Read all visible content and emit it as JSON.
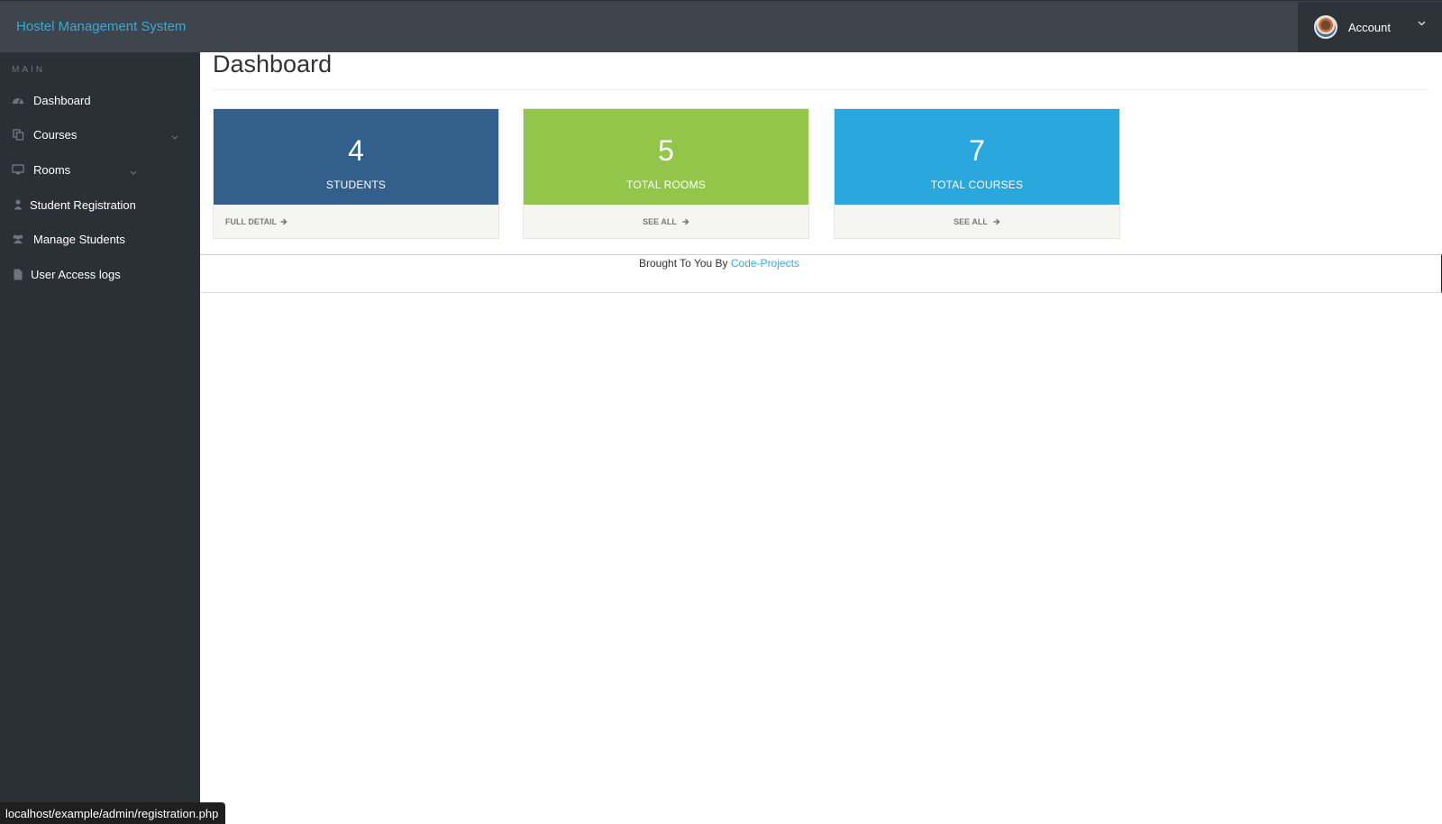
{
  "header": {
    "brand": "Hostel Management System",
    "account_label": "Account"
  },
  "sidebar": {
    "heading": "MAIN",
    "items": [
      {
        "label": "Dashboard",
        "icon": "dashboard-icon"
      },
      {
        "label": "Courses",
        "icon": "copy-icon",
        "expandable": true
      },
      {
        "label": "Rooms",
        "icon": "desktop-icon",
        "expandable": true
      },
      {
        "label": "Student Registration",
        "icon": "user-icon"
      },
      {
        "label": "Manage Students",
        "icon": "users-icon"
      },
      {
        "label": "User Access logs",
        "icon": "file-icon"
      }
    ]
  },
  "main": {
    "title": "Dashboard",
    "cards": [
      {
        "value": "4",
        "label": "STUDENTS",
        "link": "FULL DETAIL",
        "color": "#335f8c"
      },
      {
        "value": "5",
        "label": "TOTAL ROOMS",
        "link": "SEE ALL",
        "color": "#93c54b"
      },
      {
        "value": "7",
        "label": "TOTAL COURSES",
        "link": "SEE ALL",
        "color": "#2aa8de"
      }
    ]
  },
  "footer": {
    "text": "Brought To You By",
    "link": "Code-Projects"
  },
  "status_bar": {
    "url": "localhost/example/admin/registration.php"
  },
  "colors": {
    "topbar": "#3e454c",
    "sidebar": "#2b2f36",
    "accent": "#3aa9d8"
  }
}
